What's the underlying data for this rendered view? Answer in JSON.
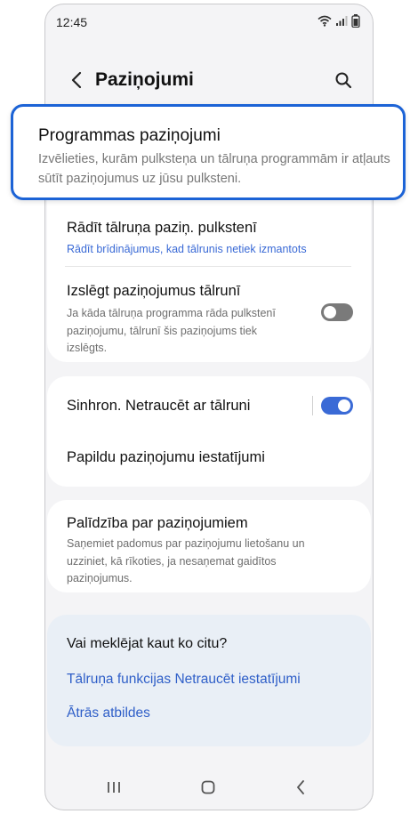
{
  "status_bar": {
    "time": "12:45",
    "icons": [
      "wifi-icon",
      "signal-icon",
      "battery-icon"
    ]
  },
  "header": {
    "title": "Paziņojumi",
    "back_icon": "back-chevron-icon",
    "search_icon": "search-icon"
  },
  "callout": {
    "title": "Programmas paziņojumi",
    "subtitle": "Izvēlieties, kurām pulksteņa un tālruņa programmām ir atļauts sūtīt paziņojumus uz jūsu pulksteni."
  },
  "settings": {
    "show_phone_notif": {
      "title": "Rādīt tālruņa paziņ. pulkstenī",
      "subtitle": "Rādīt brīdinājumus, kad tālrunis netiek izmantots"
    },
    "mute_on_phone": {
      "title": "Izslēgt paziņojumus tālrunī",
      "subtitle": "Ja kāda tālruņa programma rāda pulkstenī paziņojumu, tālrunī šis paziņojums tiek izslēgts.",
      "enabled": false
    },
    "sync_dnd": {
      "title": "Sinhron. Netraucēt ar tālruni",
      "enabled": true
    },
    "advanced": {
      "title": "Papildu paziņojumu iestatījumi"
    },
    "help": {
      "title": "Palīdzība par paziņojumiem",
      "subtitle": "Saņemiet padomus par paziņojumu lietošanu un uzziniet, kā rīkoties, ja nesaņemat gaidītos paziņojumus."
    }
  },
  "suggestions": {
    "heading": "Vai meklējat kaut ko citu?",
    "links": [
      "Tālruņa funkcijas Netraucēt iestatījumi",
      "Ātrās atbildes"
    ]
  },
  "nav_bar": {
    "icons": [
      "recents-icon",
      "home-icon",
      "back-icon"
    ]
  },
  "colors": {
    "accent": "#3a6ad6",
    "callout_border": "#1c63d6",
    "toggle_off": "#7a7a7a",
    "suggestion_bg": "#e9eff6"
  }
}
